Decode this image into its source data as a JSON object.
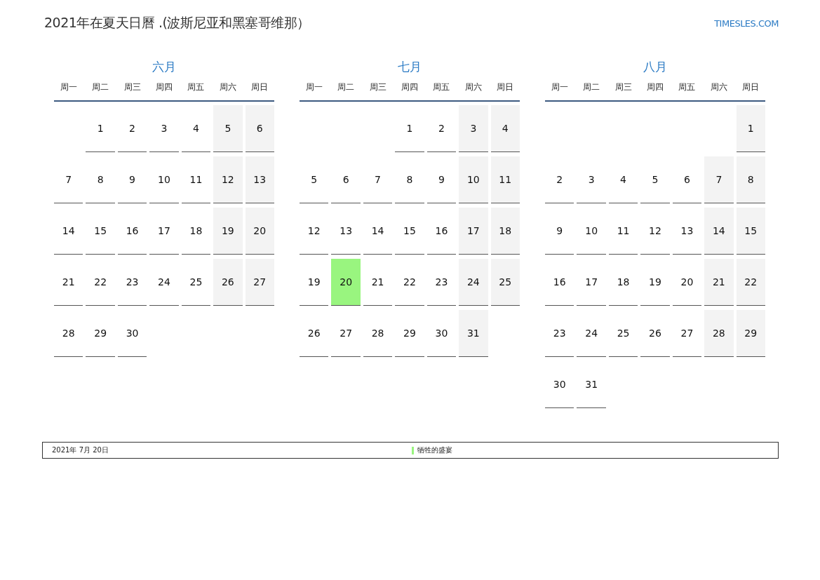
{
  "title": "2021年在夏天日曆 .(波斯尼亚和黑塞哥维那）",
  "logo": "TIMESLES.COM",
  "months": [
    {
      "name": "六月",
      "weekdays": [
        "周一",
        "周二",
        "周三",
        "周四",
        "周五",
        "周六",
        "周日"
      ],
      "weeks": [
        {
          "right_aligned": true,
          "days": [
            {
              "day": "1",
              "holiday": false
            },
            {
              "day": "2",
              "holiday": false
            },
            {
              "day": "3",
              "holiday": false
            },
            {
              "day": "4",
              "holiday": false
            },
            {
              "day": "5",
              "holiday": false
            },
            {
              "day": "6",
              "holiday": false
            }
          ]
        },
        {
          "days": [
            {
              "day": "7",
              "holiday": false
            },
            {
              "day": "8",
              "holiday": false
            },
            {
              "day": "9",
              "holiday": false
            },
            {
              "day": "10",
              "holiday": false
            },
            {
              "day": "11",
              "holiday": false
            },
            {
              "day": "12",
              "holiday": false
            },
            {
              "day": "13",
              "holiday": false
            }
          ]
        },
        {
          "days": [
            {
              "day": "14",
              "holiday": false
            },
            {
              "day": "15",
              "holiday": false
            },
            {
              "day": "16",
              "holiday": false
            },
            {
              "day": "17",
              "holiday": false
            },
            {
              "day": "18",
              "holiday": false
            },
            {
              "day": "19",
              "holiday": false
            },
            {
              "day": "20",
              "holiday": false
            }
          ]
        },
        {
          "days": [
            {
              "day": "21",
              "holiday": false
            },
            {
              "day": "22",
              "holiday": false
            },
            {
              "day": "23",
              "holiday": false
            },
            {
              "day": "24",
              "holiday": false
            },
            {
              "day": "25",
              "holiday": false
            },
            {
              "day": "26",
              "holiday": false
            },
            {
              "day": "27",
              "holiday": false
            }
          ]
        },
        {
          "right_aligned": false,
          "days": [
            {
              "day": "28",
              "holiday": false
            },
            {
              "day": "29",
              "holiday": false
            },
            {
              "day": "30",
              "holiday": false
            }
          ]
        }
      ]
    },
    {
      "name": "七月",
      "weekdays": [
        "周一",
        "周二",
        "周三",
        "周四",
        "周五",
        "周六",
        "周日"
      ],
      "weeks": [
        {
          "right_aligned": true,
          "days": [
            {
              "day": "1",
              "holiday": false
            },
            {
              "day": "2",
              "holiday": false
            },
            {
              "day": "3",
              "holiday": false
            },
            {
              "day": "4",
              "holiday": false
            }
          ]
        },
        {
          "days": [
            {
              "day": "5",
              "holiday": false
            },
            {
              "day": "6",
              "holiday": false
            },
            {
              "day": "7",
              "holiday": false
            },
            {
              "day": "8",
              "holiday": false
            },
            {
              "day": "9",
              "holiday": false
            },
            {
              "day": "10",
              "holiday": false
            },
            {
              "day": "11",
              "holiday": false
            }
          ]
        },
        {
          "days": [
            {
              "day": "12",
              "holiday": false
            },
            {
              "day": "13",
              "holiday": false
            },
            {
              "day": "14",
              "holiday": false
            },
            {
              "day": "15",
              "holiday": false
            },
            {
              "day": "16",
              "holiday": false
            },
            {
              "day": "17",
              "holiday": false
            },
            {
              "day": "18",
              "holiday": false
            }
          ]
        },
        {
          "days": [
            {
              "day": "19",
              "holiday": false
            },
            {
              "day": "20",
              "holiday": true
            },
            {
              "day": "21",
              "holiday": false
            },
            {
              "day": "22",
              "holiday": false
            },
            {
              "day": "23",
              "holiday": false
            },
            {
              "day": "24",
              "holiday": false
            },
            {
              "day": "25",
              "holiday": false
            }
          ]
        },
        {
          "right_aligned": false,
          "days": [
            {
              "day": "26",
              "holiday": false
            },
            {
              "day": "27",
              "holiday": false
            },
            {
              "day": "28",
              "holiday": false
            },
            {
              "day": "29",
              "holiday": false
            },
            {
              "day": "30",
              "holiday": false
            },
            {
              "day": "31",
              "holiday": false
            }
          ]
        }
      ]
    },
    {
      "name": "八月",
      "weekdays": [
        "周一",
        "周二",
        "周三",
        "周四",
        "周五",
        "周六",
        "周日"
      ],
      "weeks": [
        {
          "right_aligned": true,
          "days": [
            {
              "day": "1",
              "holiday": false
            }
          ]
        },
        {
          "days": [
            {
              "day": "2",
              "holiday": false
            },
            {
              "day": "3",
              "holiday": false
            },
            {
              "day": "4",
              "holiday": false
            },
            {
              "day": "5",
              "holiday": false
            },
            {
              "day": "6",
              "holiday": false
            },
            {
              "day": "7",
              "holiday": false
            },
            {
              "day": "8",
              "holiday": false
            }
          ]
        },
        {
          "days": [
            {
              "day": "9",
              "holiday": false
            },
            {
              "day": "10",
              "holiday": false
            },
            {
              "day": "11",
              "holiday": false
            },
            {
              "day": "12",
              "holiday": false
            },
            {
              "day": "13",
              "holiday": false
            },
            {
              "day": "14",
              "holiday": false
            },
            {
              "day": "15",
              "holiday": false
            }
          ]
        },
        {
          "days": [
            {
              "day": "16",
              "holiday": false
            },
            {
              "day": "17",
              "holiday": false
            },
            {
              "day": "18",
              "holiday": false
            },
            {
              "day": "19",
              "holiday": false
            },
            {
              "day": "20",
              "holiday": false
            },
            {
              "day": "21",
              "holiday": false
            },
            {
              "day": "22",
              "holiday": false
            }
          ]
        },
        {
          "days": [
            {
              "day": "23",
              "holiday": false
            },
            {
              "day": "24",
              "holiday": false
            },
            {
              "day": "25",
              "holiday": false
            },
            {
              "day": "26",
              "holiday": false
            },
            {
              "day": "27",
              "holiday": false
            },
            {
              "day": "28",
              "holiday": false
            },
            {
              "day": "29",
              "holiday": false
            }
          ]
        },
        {
          "right_aligned": false,
          "days": [
            {
              "day": "30",
              "holiday": false
            },
            {
              "day": "31",
              "holiday": false
            }
          ]
        }
      ]
    }
  ],
  "holidays": [
    {
      "date": "2021年 7月 20日",
      "name": "牺牲的盛宴",
      "color": "#99f57f"
    }
  ]
}
